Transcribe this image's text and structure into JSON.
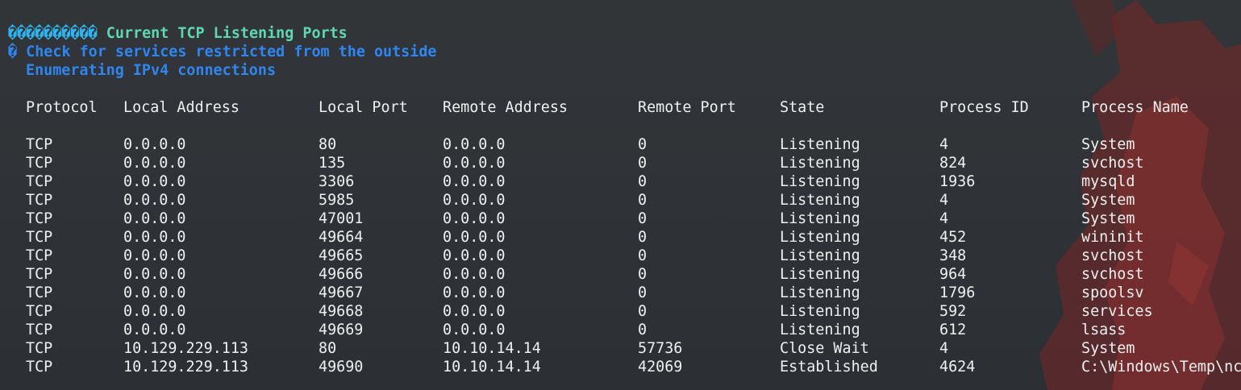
{
  "section": {
    "glyphs": "����������",
    "title": " Current TCP Listening Ports",
    "check_prefix": "� ",
    "check_text": "Check for services restricted from the outside",
    "enum_text": "Enumerating IPv4 connections"
  },
  "table": {
    "headers": [
      "Protocol",
      "Local Address",
      "Local Port",
      "Remote Address",
      "Remote Port",
      "State",
      "Process ID",
      "Process Name"
    ],
    "rows": [
      [
        "TCP",
        "0.0.0.0",
        "80",
        "0.0.0.0",
        "0",
        "Listening",
        "4",
        "System"
      ],
      [
        "TCP",
        "0.0.0.0",
        "135",
        "0.0.0.0",
        "0",
        "Listening",
        "824",
        "svchost"
      ],
      [
        "TCP",
        "0.0.0.0",
        "3306",
        "0.0.0.0",
        "0",
        "Listening",
        "1936",
        "mysqld"
      ],
      [
        "TCP",
        "0.0.0.0",
        "5985",
        "0.0.0.0",
        "0",
        "Listening",
        "4",
        "System"
      ],
      [
        "TCP",
        "0.0.0.0",
        "47001",
        "0.0.0.0",
        "0",
        "Listening",
        "4",
        "System"
      ],
      [
        "TCP",
        "0.0.0.0",
        "49664",
        "0.0.0.0",
        "0",
        "Listening",
        "452",
        "wininit"
      ],
      [
        "TCP",
        "0.0.0.0",
        "49665",
        "0.0.0.0",
        "0",
        "Listening",
        "348",
        "svchost"
      ],
      [
        "TCP",
        "0.0.0.0",
        "49666",
        "0.0.0.0",
        "0",
        "Listening",
        "964",
        "svchost"
      ],
      [
        "TCP",
        "0.0.0.0",
        "49667",
        "0.0.0.0",
        "0",
        "Listening",
        "1796",
        "spoolsv"
      ],
      [
        "TCP",
        "0.0.0.0",
        "49668",
        "0.0.0.0",
        "0",
        "Listening",
        "592",
        "services"
      ],
      [
        "TCP",
        "0.0.0.0",
        "49669",
        "0.0.0.0",
        "0",
        "Listening",
        "612",
        "lsass"
      ],
      [
        "TCP",
        "10.129.229.113",
        "80",
        "10.10.14.14",
        "57736",
        "Close Wait",
        "4",
        "System"
      ],
      [
        "TCP",
        "10.129.229.113",
        "49690",
        "10.10.14.14",
        "42069",
        "Established",
        "4624",
        "C:\\Windows\\Temp\\nc"
      ]
    ]
  },
  "colors": {
    "background": "#30343a",
    "title_green": "#5fd7af",
    "glyph_cyan": "#2fb4f0",
    "info_blue": "#2f86f0",
    "text": "#f0f0f0",
    "wallpaper_red": "#8a2a2a"
  }
}
